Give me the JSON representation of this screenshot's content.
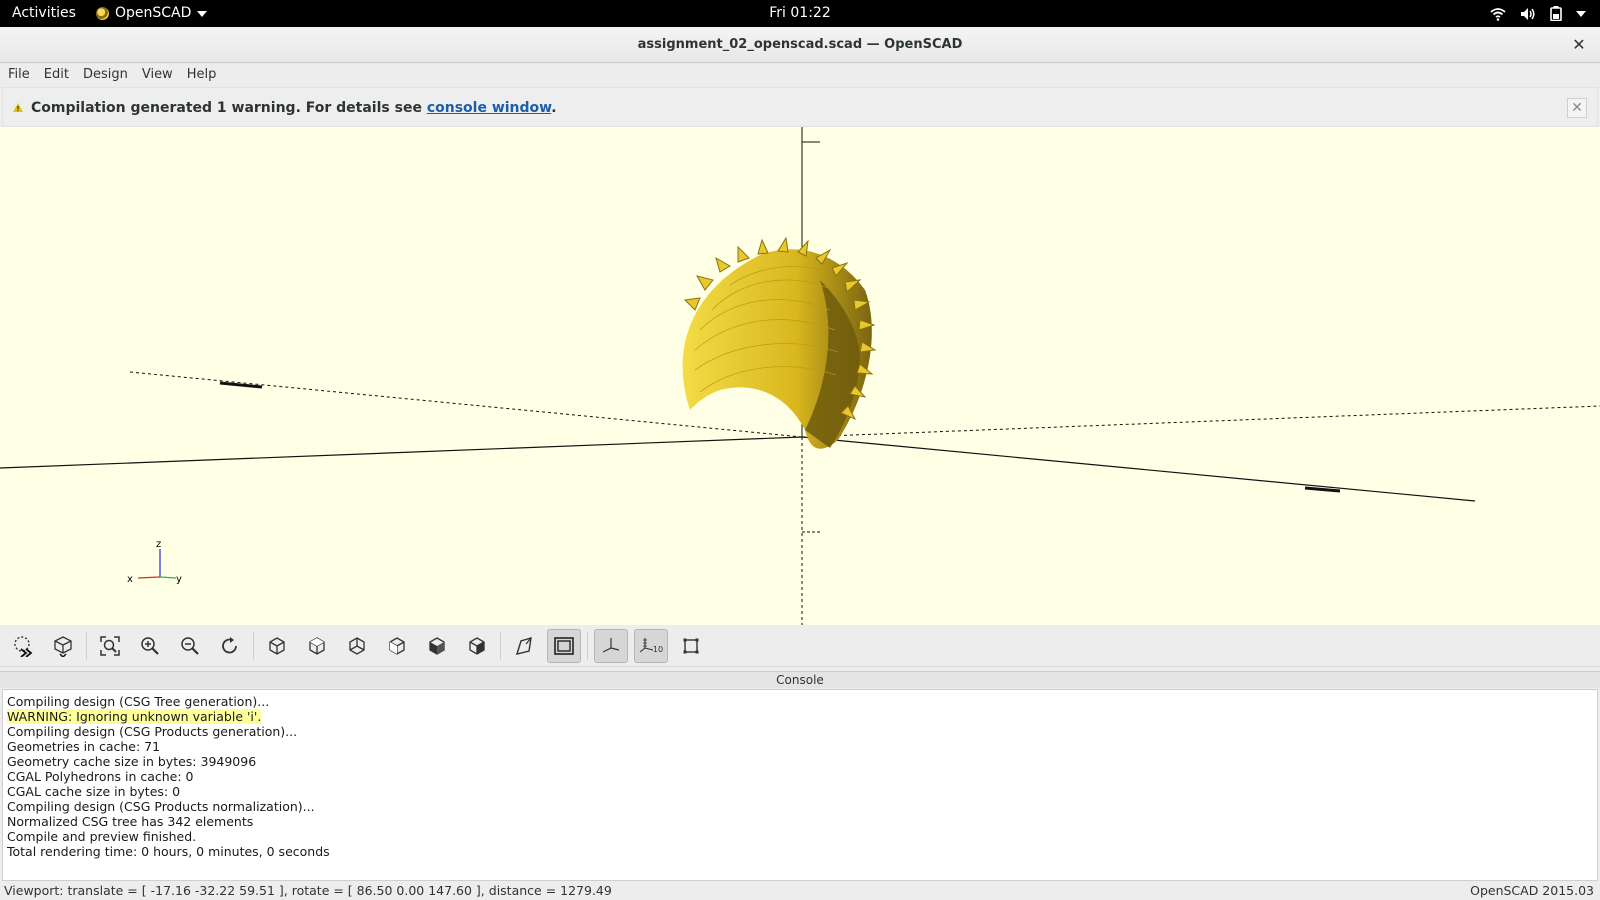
{
  "topbar": {
    "activities": "Activities",
    "app_name": "OpenSCAD",
    "clock": "Fri 01:22",
    "icons": [
      "wifi-icon",
      "volume-icon",
      "battery-icon",
      "chevron-down-icon"
    ]
  },
  "window": {
    "title": "assignment_02_openscad.scad — OpenSCAD",
    "close_glyph": "✕"
  },
  "menu": {
    "items": [
      "File",
      "Edit",
      "Design",
      "View",
      "Help"
    ]
  },
  "warning": {
    "text_before": "Compilation generated 1 warning. For details see ",
    "link": "console window",
    "text_after": ".",
    "close_glyph": "✕"
  },
  "viewport": {
    "background": "#ffffe5",
    "model_color": "#f0d02a",
    "axis_labels": {
      "x": "x",
      "y": "y",
      "z": "z"
    }
  },
  "toolbar": {
    "tools": [
      "preview-button",
      "render-button",
      "view-all-button",
      "zoom-in-button",
      "zoom-out-button",
      "reset-view-button",
      "view-right-button",
      "view-top-button",
      "view-bottom-button",
      "view-left-button",
      "view-front-button",
      "view-back-button",
      "perspective-button",
      "orthogonal-button",
      "show-axes-button",
      "show-scale-markers-button",
      "show-edges-button"
    ],
    "scale_label": "10"
  },
  "console": {
    "header": "Console",
    "lines": [
      "Compiling design (CSG Tree generation)...",
      "WARNING: Ignoring unknown variable 'i'.",
      "Compiling design (CSG Products generation)...",
      "Geometries in cache: 71",
      "Geometry cache size in bytes: 3949096",
      "CGAL Polyhedrons in cache: 0",
      "CGAL cache size in bytes: 0",
      "Compiling design (CSG Products normalization)...",
      "Normalized CSG tree has 342 elements",
      "Compile and preview finished.",
      "Total rendering time: 0 hours, 0 minutes, 0 seconds"
    ]
  },
  "status": {
    "viewport": "Viewport: translate = [ -17.16 -32.22 59.51 ], rotate = [ 86.50 0.00 147.60 ], distance = 1279.49",
    "version": "OpenSCAD 2015.03"
  }
}
